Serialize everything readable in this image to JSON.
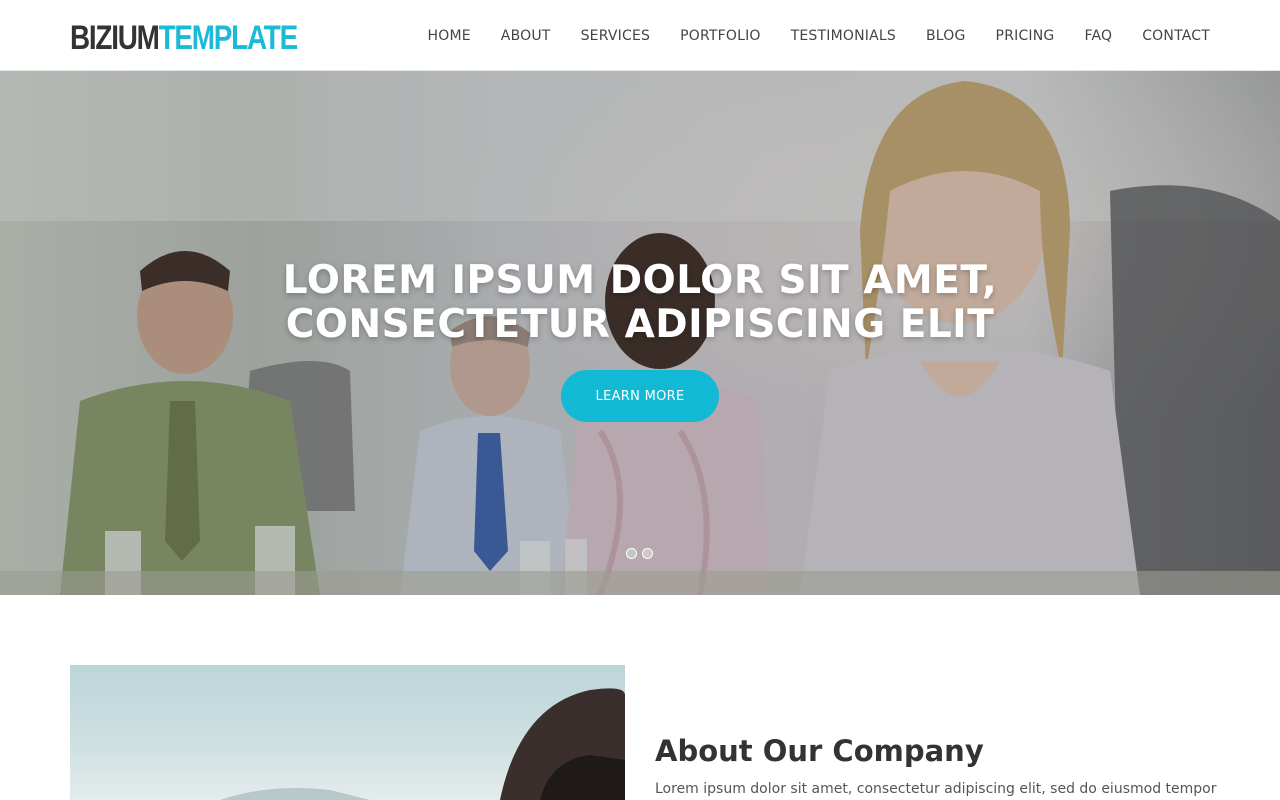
{
  "header": {
    "logo_part1": "BIZIUM",
    "logo_part2": "TEMPLATE",
    "nav": [
      "HOME",
      "ABOUT",
      "SERVICES",
      "PORTFOLIO",
      "TESTIMONIALS",
      "BLOG",
      "PRICING",
      "FAQ",
      "CONTACT"
    ]
  },
  "hero": {
    "title_line1": "LOREM IPSUM DOLOR SIT AMET,",
    "title_line2": "CONSECTETUR ADIPISCING ELIT",
    "button_label": "LEARN MORE",
    "slides_count": 2,
    "active_slide": 1
  },
  "about": {
    "title": "About Our Company",
    "text": "Lorem ipsum dolor sit amet, consectetur adipiscing elit, sed do eiusmod tempor"
  },
  "colors": {
    "accent": "#1bbad6",
    "button": "#12b9d4",
    "text_dark": "#333333"
  }
}
